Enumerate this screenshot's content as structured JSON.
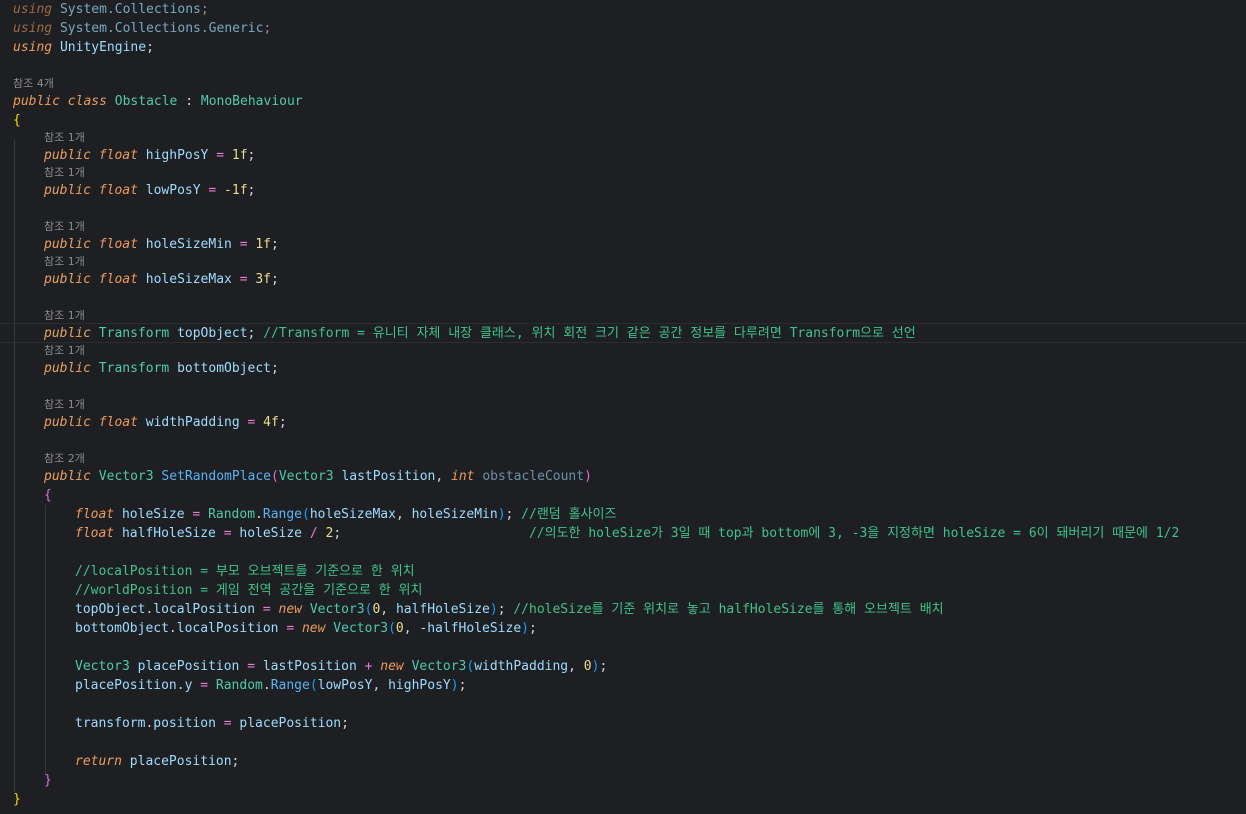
{
  "usings": [
    {
      "keyword": "using",
      "ns": "System.Collections",
      "end": ";"
    },
    {
      "keyword": "using",
      "ns": "System.Collections.Generic",
      "end": ";"
    },
    {
      "keyword": "using",
      "ns": "UnityEngine",
      "end": ";"
    }
  ],
  "refs": {
    "class": "참조 4개",
    "one": "참조 1개",
    "two": "참조 2개"
  },
  "class_decl": {
    "kw_public": "public",
    "kw_class": "class",
    "name": "Obstacle",
    "colon": ":",
    "base": "MonoBehaviour"
  },
  "fields": {
    "highPosY": {
      "type": "float",
      "name": "highPosY",
      "value": "1f"
    },
    "lowPosY": {
      "type": "float",
      "name": "lowPosY",
      "value": "-1f"
    },
    "holeSizeMin": {
      "type": "float",
      "name": "holeSizeMin",
      "value": "1f"
    },
    "holeSizeMax": {
      "type": "float",
      "name": "holeSizeMax",
      "value": "3f"
    },
    "topObject": {
      "type": "Transform",
      "name": "topObject",
      "comment": "//Transform = 유니티 자체 내장 클래스, 위치 회전 크기 같은 공간 정보를 다루려면 Transform으로 선언"
    },
    "bottomObject": {
      "type": "Transform",
      "name": "bottomObject"
    },
    "widthPadding": {
      "type": "float",
      "name": "widthPadding",
      "value": "4f"
    }
  },
  "method": {
    "return_type": "Vector3",
    "name": "SetRandomPlace",
    "param1_type": "Vector3",
    "param1": "lastPosition",
    "param2_type": "int",
    "param2": "obstacleCount"
  },
  "body": {
    "comment_hole": "//랜덤 홀사이즈",
    "comment_half": "//의도한 holeSize가 3일 때 top과 bottom에 3, -3을 지정하면 holeSize = 6이 돼버리기 때문에 1/2",
    "comment_local": "//localPosition = 부모 오브젝트를 기준으로 한 위치",
    "comment_world": "//worldPosition = 게임 전역 공간을 기준으로 한 위치",
    "comment_top": "//holeSize를 기준 위치로 놓고 halfHoleSize를 통해 오브젝트 배치"
  }
}
